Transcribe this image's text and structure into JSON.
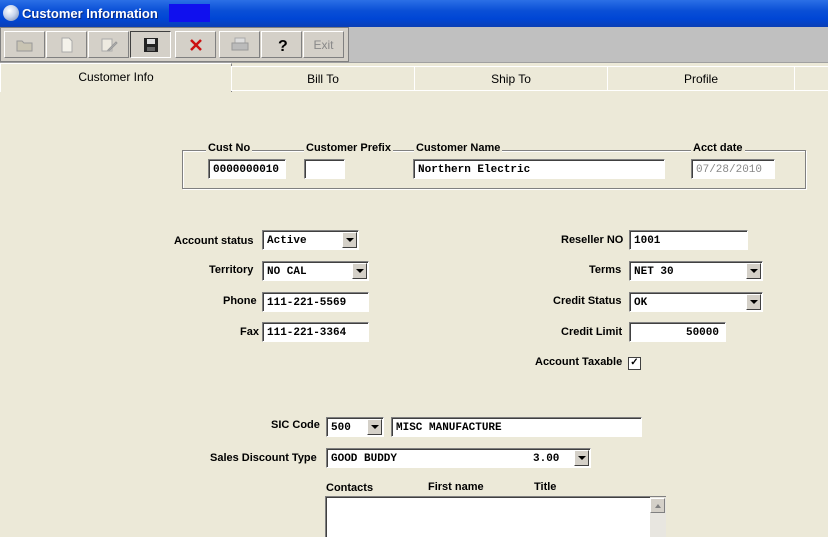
{
  "window": {
    "title": "Customer Information"
  },
  "toolbar": {
    "buttons": [
      {
        "icon": "open-folder-icon",
        "label": ""
      },
      {
        "icon": "new-document-icon",
        "label": ""
      },
      {
        "icon": "edit-icon",
        "label": ""
      },
      {
        "icon": "save-icon",
        "label": ""
      },
      {
        "icon": "delete-icon",
        "label": ""
      },
      {
        "icon": "print-icon",
        "label": ""
      },
      {
        "icon": "help-icon",
        "label": ""
      },
      {
        "icon": "",
        "label": "Exit"
      }
    ]
  },
  "tabs": [
    "Customer Info",
    "Bill To",
    "Ship To",
    "Profile"
  ],
  "header": {
    "cust_no_label": "Cust No",
    "cust_no": "0000000010",
    "prefix_label": "Customer Prefix",
    "prefix": "",
    "name_label": "Customer Name",
    "name": "Northern Electric",
    "acct_date_label": "Acct date",
    "acct_date": "07/28/2010"
  },
  "left": {
    "account_status_label": "Account status",
    "account_status": "Active",
    "territory_label": "Territory",
    "territory": "NO CAL",
    "phone_label": "Phone",
    "phone": "111-221-5569",
    "fax_label": "Fax",
    "fax": "111-221-3364"
  },
  "right": {
    "reseller_label": "Reseller NO",
    "reseller": "1001",
    "terms_label": "Terms",
    "terms": "NET 30",
    "credit_status_label": "Credit Status",
    "credit_status": "OK",
    "credit_limit_label": "Credit Limit",
    "credit_limit": "50000",
    "taxable_label": "Account Taxable",
    "taxable_mark": "✓"
  },
  "sic": {
    "label": "SIC Code",
    "code": "500",
    "description": "MISC MANUFACTURE"
  },
  "discount": {
    "label": "Sales Discount Type",
    "value_name": "GOOD BUDDY",
    "value_amount": "3.00"
  },
  "contacts": {
    "label": "Contacts",
    "col_first": "First name",
    "col_title": "Title"
  },
  "colors": {
    "titlebar": "#0046d5",
    "background": "#ece9d8"
  }
}
